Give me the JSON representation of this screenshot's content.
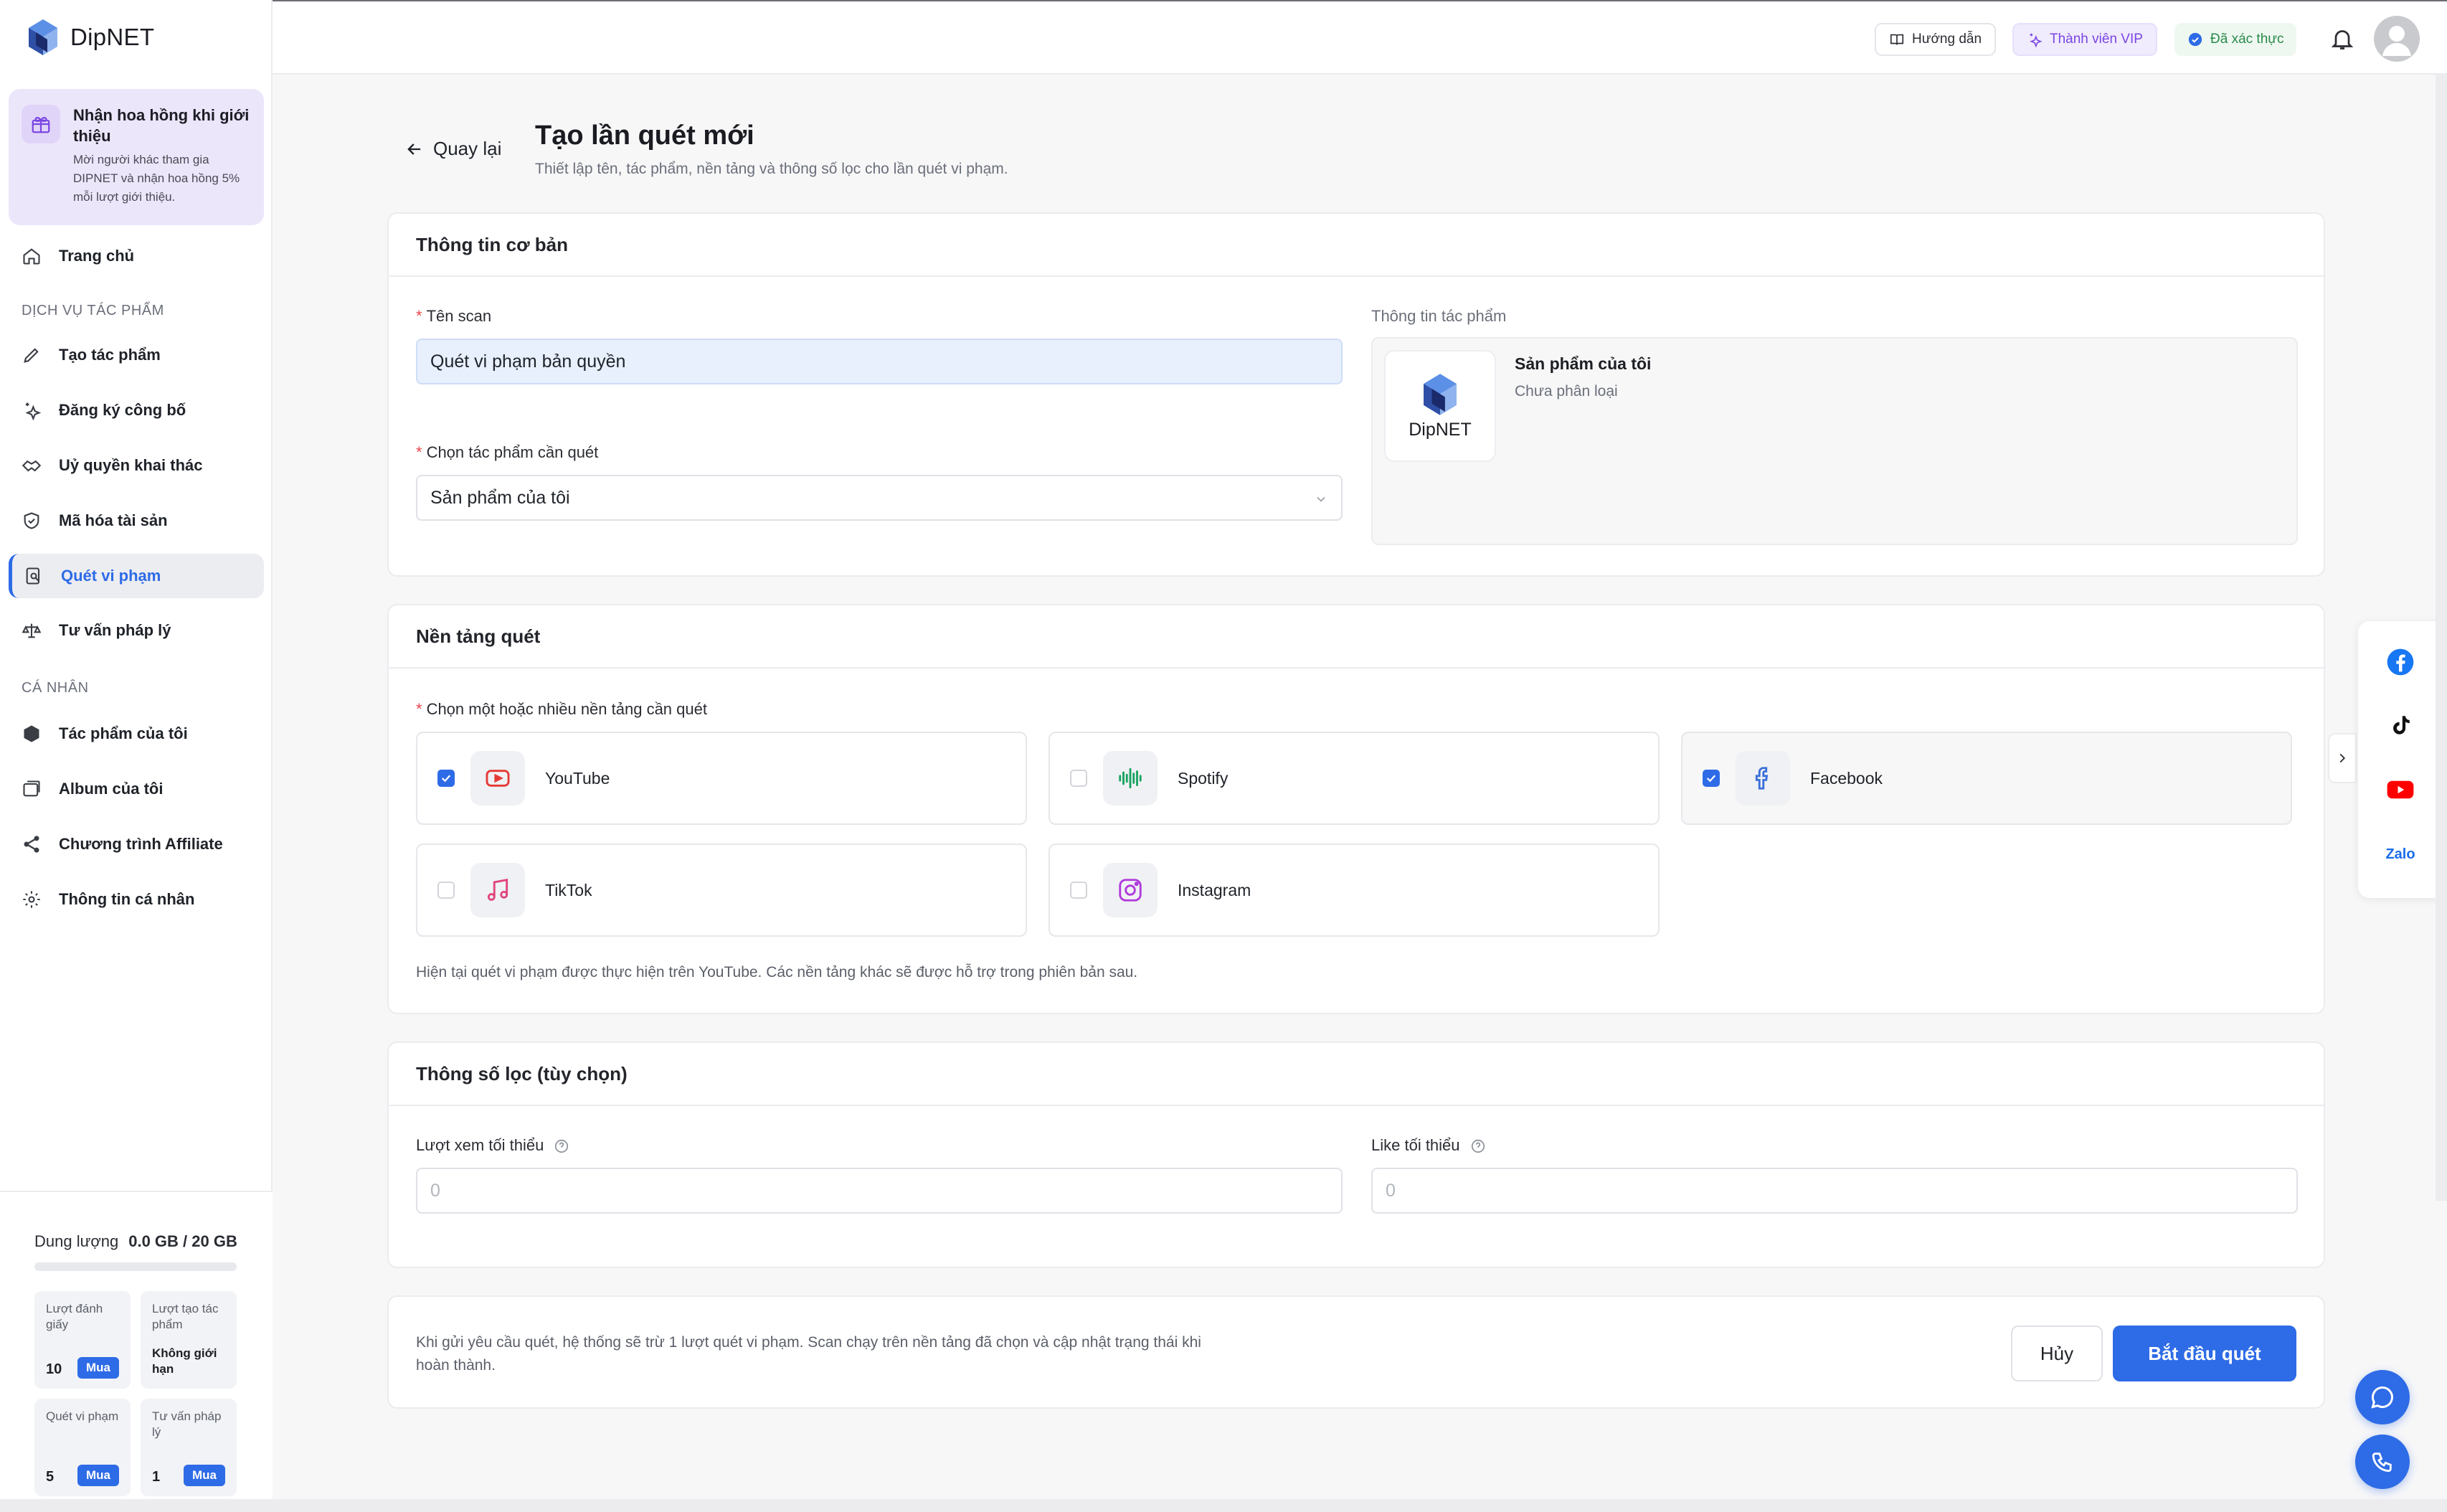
{
  "brand": {
    "name": "DipNET",
    "accent": "#2e6be6"
  },
  "promo": {
    "title": "Nhận hoa hồng khi giới thiệu",
    "desc": "Mời người khác tham gia DIPNET và nhận hoa hồng 5% mỗi lượt giới thiệu."
  },
  "sidebar": {
    "home": "Trang chủ",
    "section_services": "DỊCH VỤ TÁC PHẨM",
    "items": [
      {
        "label": "Tạo tác phẩm",
        "icon": "pen-icon"
      },
      {
        "label": "Đăng ký công bố",
        "icon": "sparkle-icon"
      },
      {
        "label": "Uỷ quyền khai thác",
        "icon": "handshake-icon"
      },
      {
        "label": "Mã hóa tài sản",
        "icon": "shield-icon"
      },
      {
        "label": "Quét vi phạm",
        "icon": "scan-icon",
        "active": true
      },
      {
        "label": "Tư vấn pháp lý",
        "icon": "legal-icon"
      }
    ],
    "section_personal": "CÁ NHÂN",
    "personal_items": [
      {
        "label": "Tác phẩm của tôi",
        "icon": "box-icon"
      },
      {
        "label": "Album của tôi",
        "icon": "album-icon"
      },
      {
        "label": "Chương trình Affiliate",
        "icon": "share-icon"
      },
      {
        "label": "Thông tin cá nhân",
        "icon": "gear-icon"
      }
    ]
  },
  "storage": {
    "label": "Dung lượng",
    "value": "0.0 GB / 20 GB",
    "used_fraction": 0.0,
    "quotas": [
      {
        "label": "Lượt đánh giấy",
        "value": "10",
        "buy": "Mua"
      },
      {
        "label": "Lượt tạo tác phẩm",
        "value": "Không giới hạn"
      },
      {
        "label": "Quét vi phạm",
        "value": "5",
        "buy": "Mua"
      },
      {
        "label": "Tư vấn pháp lý",
        "value": "1",
        "buy": "Mua"
      }
    ]
  },
  "topbar": {
    "guide": "Hướng dẫn",
    "vip": "Thành viên VIP",
    "verified": "Đã xác thực"
  },
  "page": {
    "back": "Quay lại",
    "title": "Tạo lần quét mới",
    "subtitle": "Thiết lập tên, tác phẩm, nền tảng và thông số lọc cho lần quét vi phạm."
  },
  "basic": {
    "heading": "Thông tin cơ bản",
    "scan_name_label": "Tên scan",
    "scan_name_value": "Quét vi phạm bản quyền",
    "work_label": "Chọn tác phẩm cần quét",
    "work_value": "Sản phẩm của tôi",
    "work_info_label": "Thông tin tác phẩm",
    "work_name": "Sản phẩm của tôi",
    "work_category": "Chưa phân loại",
    "thumb_text": "DipNET"
  },
  "platforms": {
    "heading": "Nền tảng quét",
    "label": "Chọn một hoặc nhiều nền tảng cần quét",
    "items": [
      {
        "name": "YouTube",
        "checked": true,
        "icon": "youtube-icon",
        "color": "#e53935"
      },
      {
        "name": "Spotify",
        "checked": false,
        "icon": "audio-wave-icon",
        "color": "#1aa260"
      },
      {
        "name": "Facebook",
        "checked": true,
        "icon": "facebook-icon",
        "color": "#3b6fd8"
      },
      {
        "name": "TikTok",
        "checked": false,
        "icon": "music-note-icon",
        "color": "#e0457b"
      },
      {
        "name": "Instagram",
        "checked": false,
        "icon": "instagram-icon",
        "color": "#b03adb"
      }
    ],
    "note": "Hiện tại quét vi phạm được thực hiện trên YouTube. Các nền tảng khác sẽ được hỗ trợ trong phiên bản sau."
  },
  "filters": {
    "heading": "Thông số lọc (tùy chọn)",
    "min_views_label": "Lượt xem tối thiểu",
    "min_views_placeholder": "0",
    "min_likes_label": "Like tối thiểu",
    "min_likes_placeholder": "0"
  },
  "footer": {
    "note": "Khi gửi yêu cầu quét, hệ thống sẽ trừ 1 lượt quét vi phạm. Scan chạy trên nền tảng đã chọn và cập nhật trạng thái khi hoàn thành.",
    "cancel": "Hủy",
    "start": "Bắt đầu quét"
  },
  "social": {
    "zalo": "Zalo"
  }
}
